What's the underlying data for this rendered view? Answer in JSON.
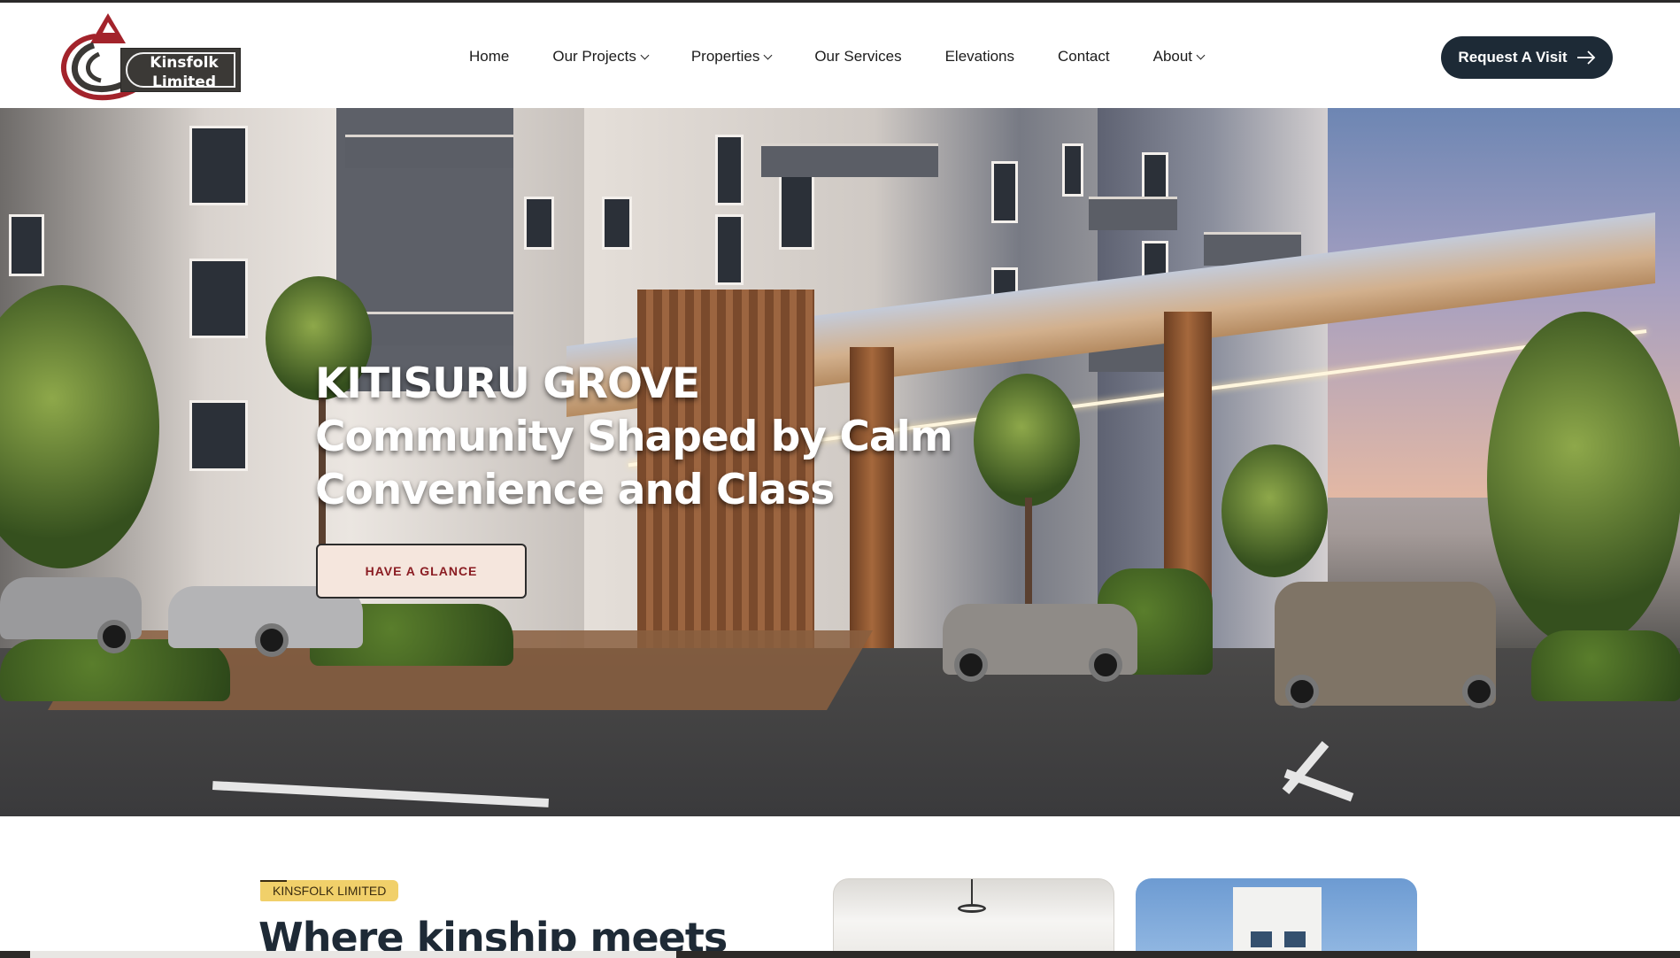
{
  "brand": {
    "name_line1": "Kinsfolk",
    "name_line2": "Limited",
    "colors": {
      "logo_red": "#a3232b",
      "logo_dark": "#3b3936"
    }
  },
  "nav": {
    "items": [
      {
        "label": "Home",
        "has_dropdown": false
      },
      {
        "label": "Our Projects",
        "has_dropdown": true
      },
      {
        "label": "Properties",
        "has_dropdown": true
      },
      {
        "label": "Our Services",
        "has_dropdown": false
      },
      {
        "label": "Elevations",
        "has_dropdown": false
      },
      {
        "label": "Contact",
        "has_dropdown": false
      },
      {
        "label": "About",
        "has_dropdown": true
      }
    ],
    "cta_label": "Request A Visit",
    "cta_icon": "arrow-right-icon",
    "cta_color": "#1d2a36"
  },
  "hero": {
    "title_line1": "KITISURU GROVE",
    "title_line2": "Community Shaped by Calm",
    "title_line3": "Convenience and Class",
    "button_label": "HAVE A GLANCE",
    "button_text_color": "#8a1c22",
    "button_bg_color": "#f5e6dd"
  },
  "intro": {
    "tag": "KINSFOLK LIMITED",
    "tag_color": "#f1d06a",
    "headline": "Where kinship meets"
  }
}
